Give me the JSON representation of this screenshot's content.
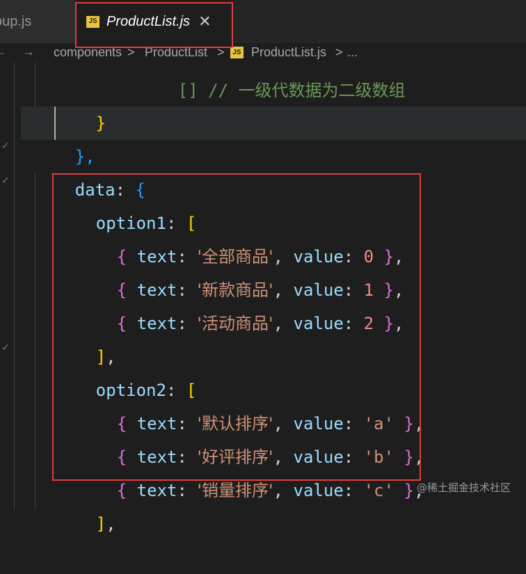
{
  "tabs": [
    {
      "label": "oup.js",
      "active": false
    },
    {
      "label": "ProductList.js",
      "active": true,
      "icon": "js-icon",
      "close_glyph": "✕"
    }
  ],
  "js_icon_text": "JS",
  "breadcrumb": {
    "back_glyph": "←",
    "forward_glyph": "→",
    "items": [
      "components",
      "ProductList",
      "ProductList.js",
      "..."
    ],
    "separator": ">"
  },
  "code": {
    "line_0_partial": "[] // 一级代数据为二级数组",
    "line_1": "}",
    "line_2": "},",
    "data_key": "data",
    "option1_key": "option1",
    "option2_key": "option2",
    "text_key": "text",
    "value_key": "value",
    "option1": [
      {
        "text": "'全部商品'",
        "value": "0"
      },
      {
        "text": "'新款商品'",
        "value": "1"
      },
      {
        "text": "'活动商品'",
        "value": "2"
      }
    ],
    "option2": [
      {
        "text": "'默认排序'",
        "value": "'a'"
      },
      {
        "text": "'好评排序'",
        "value": "'b'"
      },
      {
        "text": "'销量排序'",
        "value": "'c'"
      }
    ],
    "close_array": "],"
  },
  "watermark": "@稀土掘金技术社区",
  "colors": {
    "highlight_box": "#e03e3e",
    "js_icon": "#e8c43f",
    "background": "#1e1e1e"
  }
}
